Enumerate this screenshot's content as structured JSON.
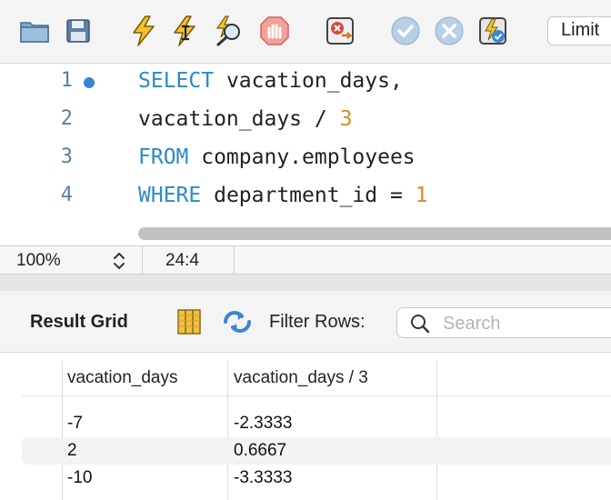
{
  "toolbar": {
    "buttons": [
      {
        "name": "open-folder",
        "icon": "folder-icon"
      },
      {
        "name": "save",
        "icon": "save-icon"
      },
      {
        "name": "execute",
        "icon": "lightning-icon"
      },
      {
        "name": "execute-current",
        "icon": "lightning-cursor-icon"
      },
      {
        "name": "explain",
        "icon": "magnifier-lightning-icon"
      },
      {
        "name": "stop",
        "icon": "stop-hand-icon"
      },
      {
        "name": "toggle-error",
        "icon": "error-toggle-icon"
      },
      {
        "name": "commit",
        "icon": "checkmark-icon"
      },
      {
        "name": "rollback",
        "icon": "cross-icon"
      },
      {
        "name": "autocommit",
        "icon": "autocommit-icon"
      }
    ],
    "limit_label": "Limit"
  },
  "editor": {
    "lines": [
      {
        "num": "1",
        "kw": "SELECT",
        "rest": " vacation_days,",
        "num_literal": ""
      },
      {
        "num": "2",
        "kw": "",
        "rest": "vacation_days / ",
        "num_literal": "3"
      },
      {
        "num": "3",
        "kw": "FROM",
        "rest": " company.employees",
        "num_literal": ""
      },
      {
        "num": "4",
        "kw": "WHERE",
        "rest": " department_id = ",
        "num_literal": "1"
      }
    ]
  },
  "status": {
    "zoom": "100%",
    "cursor": "24:4"
  },
  "result": {
    "title": "Result Grid",
    "filter_label": "Filter Rows:",
    "search_placeholder": "Search",
    "columns": [
      "vacation_days",
      "vacation_days / 3"
    ],
    "rows": [
      [
        "-7",
        "-2.3333"
      ],
      [
        "2",
        "0.6667"
      ],
      [
        "-10",
        "-3.3333"
      ]
    ]
  },
  "colors": {
    "keyword": "#2b8bc6",
    "number": "#d98c1f",
    "line_number": "#5b7fa0",
    "breakpoint_dot": "#3a86d4"
  }
}
